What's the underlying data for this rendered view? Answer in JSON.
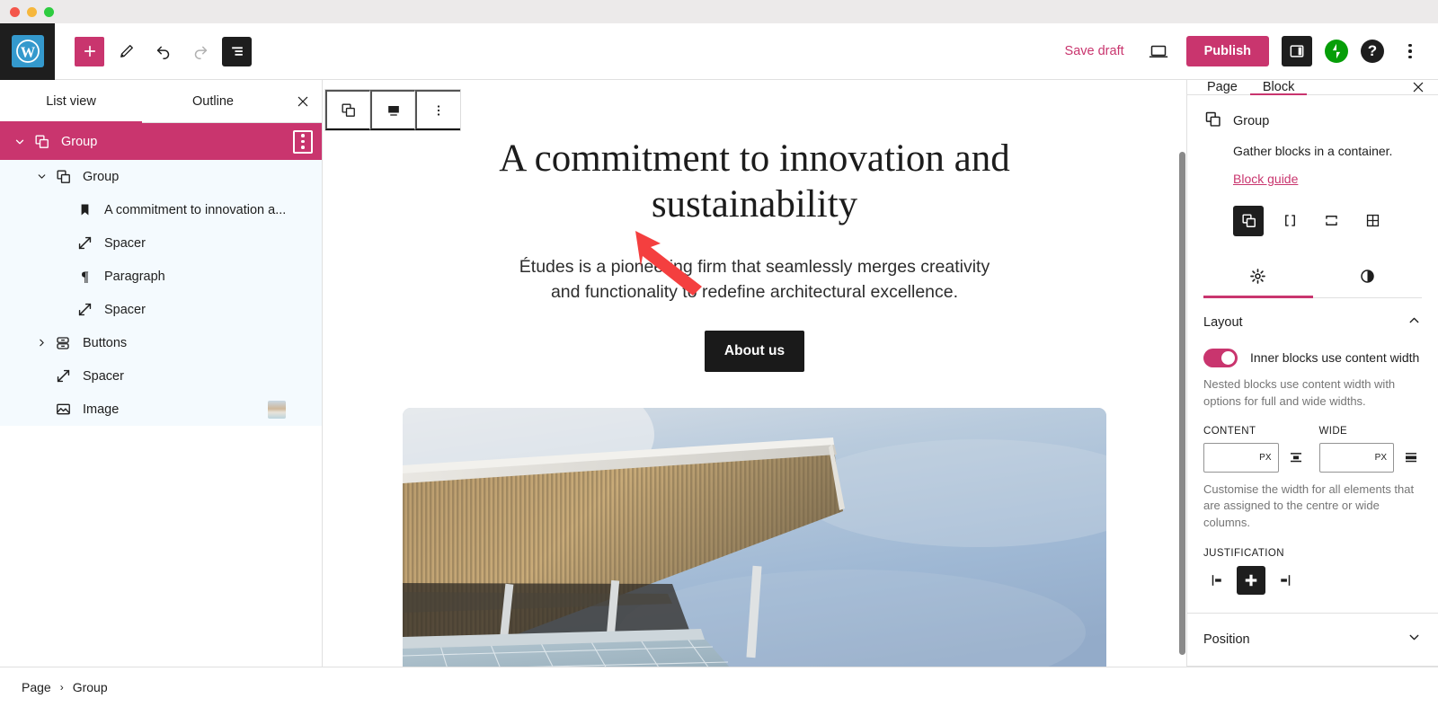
{
  "window": {
    "traffic_lights": [
      "close",
      "minimize",
      "maximize"
    ]
  },
  "toolbar": {
    "logo_name": "wordpress-logo",
    "add_label": "+",
    "tools": [
      {
        "name": "add-block-button",
        "icon": "plus-icon",
        "label": "+"
      },
      {
        "name": "edit-tool-button",
        "icon": "pencil-icon",
        "label": ""
      },
      {
        "name": "undo-button",
        "icon": "undo-arrow-icon",
        "label": ""
      },
      {
        "name": "redo-button",
        "icon": "redo-arrow-icon",
        "label": ""
      },
      {
        "name": "list-view-toggle",
        "icon": "list-view-icon",
        "label": ""
      }
    ],
    "save_draft_label": "Save draft",
    "preview_icon": "desktop-preview-icon",
    "publish_label": "Publish",
    "settings_icon": "settings-sidebar-icon",
    "jetpack_icon": "jetpack-icon",
    "help_icon": "help-question-icon",
    "options_icon": "vertical-ellipsis-icon",
    "accent_color": "#c9356e"
  },
  "list_view": {
    "tabs": [
      {
        "label": "List view",
        "active": true
      },
      {
        "label": "Outline",
        "active": false
      }
    ],
    "close_label": "✕",
    "rows": [
      {
        "label": "Group",
        "icon": "group-block-icon",
        "indent": 0,
        "chevron": "down",
        "selected": true,
        "kebab": true
      },
      {
        "label": "Group",
        "icon": "group-block-icon",
        "indent": 1,
        "chevron": "down",
        "selected": false,
        "kebab": false
      },
      {
        "label": "A commitment to innovation a...",
        "icon": "heading-bookmark-icon",
        "indent": 2,
        "chevron": "none",
        "selected": false,
        "kebab": false
      },
      {
        "label": "Spacer",
        "icon": "spacer-arrows-icon",
        "indent": 2,
        "chevron": "none",
        "selected": false,
        "kebab": false
      },
      {
        "label": "Paragraph",
        "icon": "paragraph-pilcrow-icon",
        "indent": 2,
        "chevron": "none",
        "selected": false,
        "kebab": false
      },
      {
        "label": "Spacer",
        "icon": "spacer-arrows-icon",
        "indent": 2,
        "chevron": "none",
        "selected": false,
        "kebab": false
      },
      {
        "label": "Buttons",
        "icon": "buttons-block-icon",
        "indent": 1,
        "chevron": "right",
        "selected": false,
        "kebab": false
      },
      {
        "label": "Spacer",
        "icon": "spacer-arrows-icon",
        "indent": 1,
        "chevron": "none",
        "selected": false,
        "kebab": false
      },
      {
        "label": "Image",
        "icon": "image-block-icon",
        "indent": 1,
        "chevron": "none",
        "selected": false,
        "kebab": false,
        "thumbnail": true
      }
    ]
  },
  "block_toolbar": {
    "buttons": [
      {
        "name": "block-type-group-button",
        "icon": "group-block-icon"
      },
      {
        "name": "align-button",
        "icon": "align-wide-icon"
      },
      {
        "name": "more-options-button",
        "icon": "vertical-ellipsis-icon"
      }
    ]
  },
  "canvas": {
    "title": "A commitment to innovation and sustainability",
    "paragraph": "Études is a pioneering firm that seamlessly merges creativity and functionality to redefine architectural excellence.",
    "button_label": "About us",
    "image_alt": "architectural-canopy-photo"
  },
  "settings": {
    "tabs": [
      {
        "label": "Page",
        "active": false
      },
      {
        "label": "Block",
        "active": true
      }
    ],
    "close_label": "✕",
    "block": {
      "name": "Group",
      "icon": "group-block-icon",
      "description": "Gather blocks in a container.",
      "guide_link": "Block guide",
      "variations": [
        {
          "name": "variation-group",
          "icon": "group-block-icon",
          "active": true
        },
        {
          "name": "variation-row",
          "icon": "row-layout-icon",
          "active": false
        },
        {
          "name": "variation-stack",
          "icon": "stack-layout-icon",
          "active": false
        },
        {
          "name": "variation-grid",
          "icon": "grid-layout-icon",
          "active": false
        }
      ],
      "subtabs": [
        {
          "name": "settings-subtab",
          "icon": "gear-icon",
          "active": true
        },
        {
          "name": "styles-subtab",
          "icon": "contrast-circle-icon",
          "active": false
        }
      ]
    },
    "layout": {
      "title": "Layout",
      "collapsed": false,
      "toggle_label": "Inner blocks use content width",
      "toggle_on": true,
      "help_text": "Nested blocks use content width with options for full and wide widths.",
      "content_label": "CONTENT",
      "content_value": "",
      "content_unit": "PX",
      "wide_label": "WIDE",
      "wide_value": "",
      "wide_unit": "PX",
      "width_help": "Customise the width for all elements that are assigned to the centre or wide columns.",
      "justification_label": "JUSTIFICATION",
      "justification_options": [
        {
          "name": "justify-left-button",
          "active": false
        },
        {
          "name": "justify-center-button",
          "active": true
        },
        {
          "name": "justify-right-button",
          "active": false
        }
      ]
    },
    "position": {
      "title": "Position",
      "collapsed": true
    }
  },
  "breadcrumb": {
    "items": [
      "Page",
      "Group"
    ],
    "separator": "›"
  }
}
